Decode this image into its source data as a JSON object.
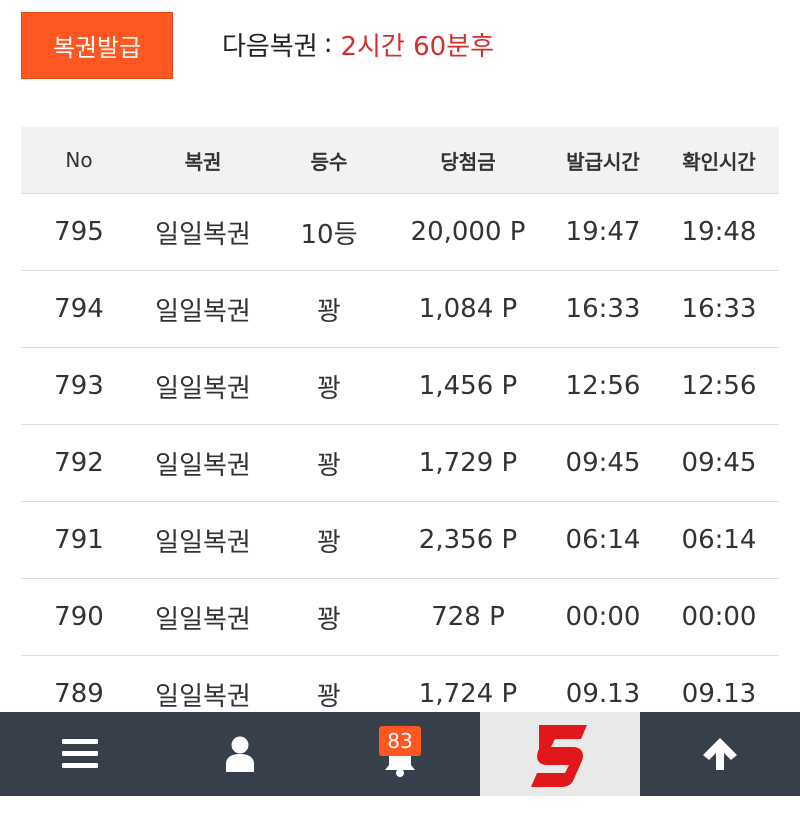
{
  "header": {
    "issue_button": "복권발급",
    "next_label": "다음복권",
    "next_sep": ":",
    "next_value": "2시간 60분후"
  },
  "table": {
    "columns": [
      "No",
      "복권",
      "등수",
      "당첨금",
      "발급시간",
      "확인시간"
    ],
    "rows": [
      [
        "795",
        "일일복권",
        "10등",
        "20,000 P",
        "19:47",
        "19:48"
      ],
      [
        "794",
        "일일복권",
        "꽝",
        "1,084 P",
        "16:33",
        "16:33"
      ],
      [
        "793",
        "일일복권",
        "꽝",
        "1,456 P",
        "12:56",
        "12:56"
      ],
      [
        "792",
        "일일복권",
        "꽝",
        "1,729 P",
        "09:45",
        "09:45"
      ],
      [
        "791",
        "일일복권",
        "꽝",
        "2,356 P",
        "06:14",
        "06:14"
      ],
      [
        "790",
        "일일복권",
        "꽝",
        "728 P",
        "00:00",
        "00:00"
      ],
      [
        "789",
        "일일복권",
        "꽝",
        "1,724 P",
        "09.13",
        "09.13"
      ]
    ]
  },
  "bottom_bar": {
    "items": [
      "menu-icon",
      "user-icon",
      "bell-icon",
      "logo",
      "arrow-up-icon"
    ],
    "notification_count": "83",
    "colors": {
      "bar": "#37404a",
      "accent": "#ff5722",
      "logo_red": "#e0181b"
    }
  }
}
